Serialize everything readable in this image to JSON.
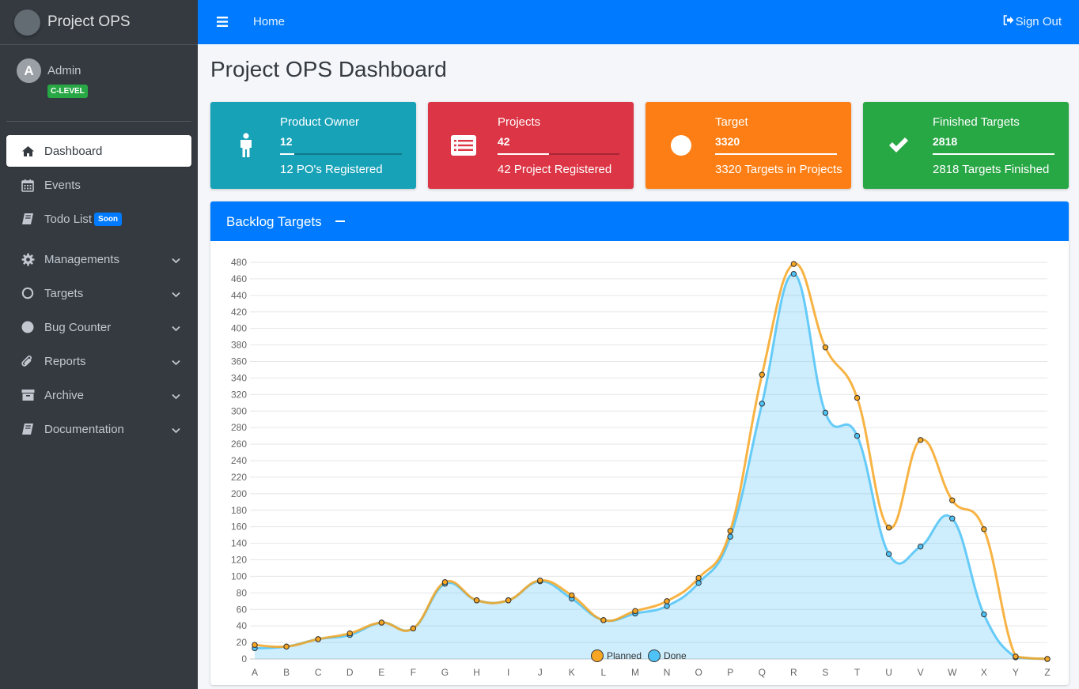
{
  "brand": {
    "name": "Project OPS"
  },
  "user": {
    "avatar_letter": "A",
    "name": "Admin",
    "role": "C-LEVEL"
  },
  "sidebar": {
    "items": [
      {
        "label": "Dashboard",
        "icon": "home-icon",
        "active": true
      },
      {
        "label": "Events",
        "icon": "calendar-icon"
      },
      {
        "label": "Todo List",
        "icon": "book-icon",
        "badge": "Soon"
      },
      {
        "label": "Managements",
        "icon": "gear-icon",
        "expandable": true
      },
      {
        "label": "Targets",
        "icon": "circle-outline-icon",
        "expandable": true
      },
      {
        "label": "Bug Counter",
        "icon": "circle-filled-icon",
        "expandable": true
      },
      {
        "label": "Reports",
        "icon": "paperclip-icon",
        "expandable": true
      },
      {
        "label": "Archive",
        "icon": "archive-icon",
        "expandable": true
      },
      {
        "label": "Documentation",
        "icon": "book-icon",
        "expandable": true
      }
    ]
  },
  "topbar": {
    "home_label": "Home",
    "signout_label": "Sign Out"
  },
  "page": {
    "title": "Project OPS Dashboard"
  },
  "info_boxes": [
    {
      "label": "Product Owner",
      "number": "12",
      "description": "12 PO's Registered",
      "color": "#17a2b8",
      "icon": "person-icon",
      "progress": 0.12
    },
    {
      "label": "Projects",
      "number": "42",
      "description": "42 Project Registered",
      "color": "#dc3545",
      "icon": "list-icon",
      "progress": 0.42
    },
    {
      "label": "Target",
      "number": "3320",
      "description": "3320 Targets in Projects",
      "color": "#fd7e14",
      "icon": "circle-icon",
      "progress": 1.0
    },
    {
      "label": "Finished Targets",
      "number": "2818",
      "description": "2818 Targets Finished",
      "color": "#28a745",
      "icon": "check-icon",
      "progress": 1.0
    }
  ],
  "backlog": {
    "title": "Backlog Targets"
  },
  "chart_data": {
    "type": "line",
    "categories": [
      "A",
      "B",
      "C",
      "D",
      "E",
      "F",
      "G",
      "H",
      "I",
      "J",
      "K",
      "L",
      "M",
      "N",
      "O",
      "P",
      "Q",
      "R",
      "S",
      "T",
      "U",
      "V",
      "W",
      "X",
      "Y",
      "Z"
    ],
    "ylim": [
      0,
      480
    ],
    "ytick_step": 20,
    "grid": true,
    "legend_position": "bottom",
    "series": [
      {
        "name": "Planned",
        "color": "#f6a623",
        "fill": false,
        "values": [
          17,
          15,
          24,
          31,
          44,
          37,
          93,
          71,
          71,
          95,
          77,
          47,
          58,
          70,
          98,
          155,
          344,
          478,
          377,
          316,
          159,
          265,
          192,
          157,
          3,
          0
        ]
      },
      {
        "name": "Done",
        "color": "#4fc3f7",
        "fill": true,
        "values": [
          13,
          15,
          24,
          29,
          44,
          37,
          91,
          71,
          71,
          94,
          73,
          47,
          55,
          64,
          92,
          148,
          309,
          466,
          298,
          270,
          127,
          136,
          170,
          54,
          2,
          0
        ]
      }
    ]
  }
}
